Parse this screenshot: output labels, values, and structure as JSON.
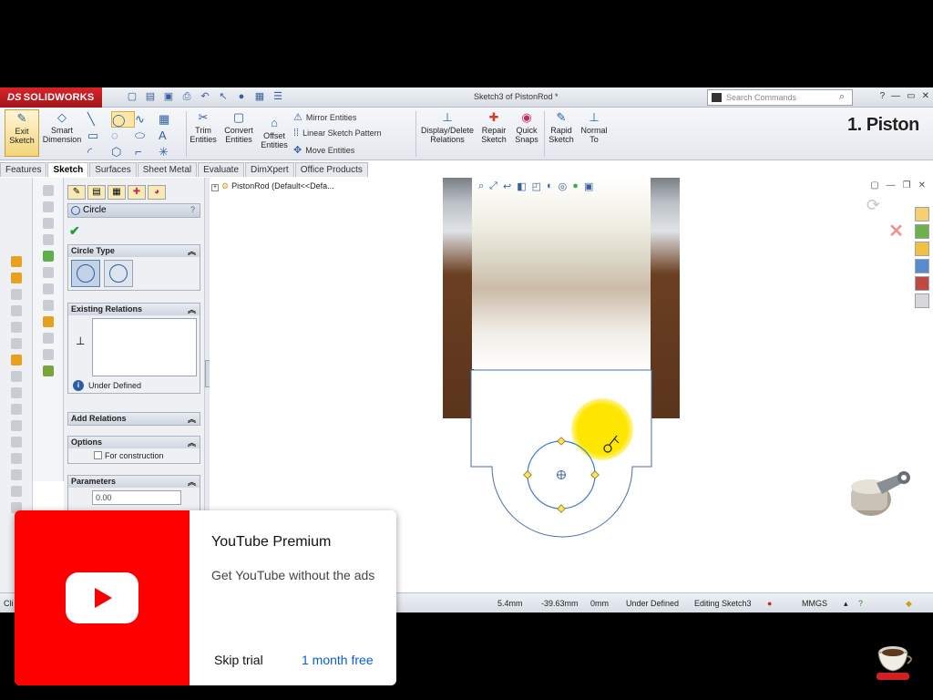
{
  "titlebar": {
    "logo": "SOLIDWORKS",
    "document_title": "Sketch3 of PistonRod *",
    "search_placeholder": "Search Commands"
  },
  "command_manager": {
    "exit_sketch": "Exit\nSketch",
    "smart_dimension": "Smart\nDimension",
    "trim_entities": "Trim\nEntities",
    "convert_entities": "Convert\nEntities",
    "offset_entities": "Offset\nEntities",
    "mirror_entities": "Mirror Entities",
    "linear_sketch_pattern": "Linear Sketch Pattern",
    "move_entities": "Move Entities",
    "display_delete_relations": "Display/Delete\nRelations",
    "repair_sketch": "Repair\nSketch",
    "quick_snaps": "Quick\nSnaps",
    "rapid_sketch": "Rapid\nSketch",
    "normal_to": "Normal\nTo"
  },
  "overlay_title": "1. Piston",
  "tabs": [
    "Features",
    "Sketch",
    "Surfaces",
    "Sheet Metal",
    "Evaluate",
    "DimXpert",
    "Office Products"
  ],
  "property_manager": {
    "title": "Circle",
    "help": "?",
    "circle_type_label": "Circle Type",
    "existing_relations_label": "Existing Relations",
    "status": "Under Defined",
    "add_relations_label": "Add Relations",
    "options_label": "Options",
    "for_construction": "For construction",
    "parameters_label": "Parameters",
    "param_value": "0.00"
  },
  "feature_tree": {
    "item": "PistonRod  (Default<<Defa..."
  },
  "status_bar": {
    "left": "Cli",
    "x": "5.4mm",
    "y": "-39.63mm",
    "z": "0mm",
    "state": "Under Defined",
    "editing": "Editing Sketch3",
    "units": "MMGS"
  },
  "youtube_promo": {
    "title": "YouTube Premium",
    "subtitle": "Get YouTube without the ads",
    "skip": "Skip trial",
    "cta": "1 month free"
  },
  "colors": {
    "brand_red": "#d8232a",
    "yt_red": "#ff0000",
    "yt_link": "#065fd4",
    "sketch_line": "#3a7fd0",
    "highlight": "#ffe600"
  }
}
